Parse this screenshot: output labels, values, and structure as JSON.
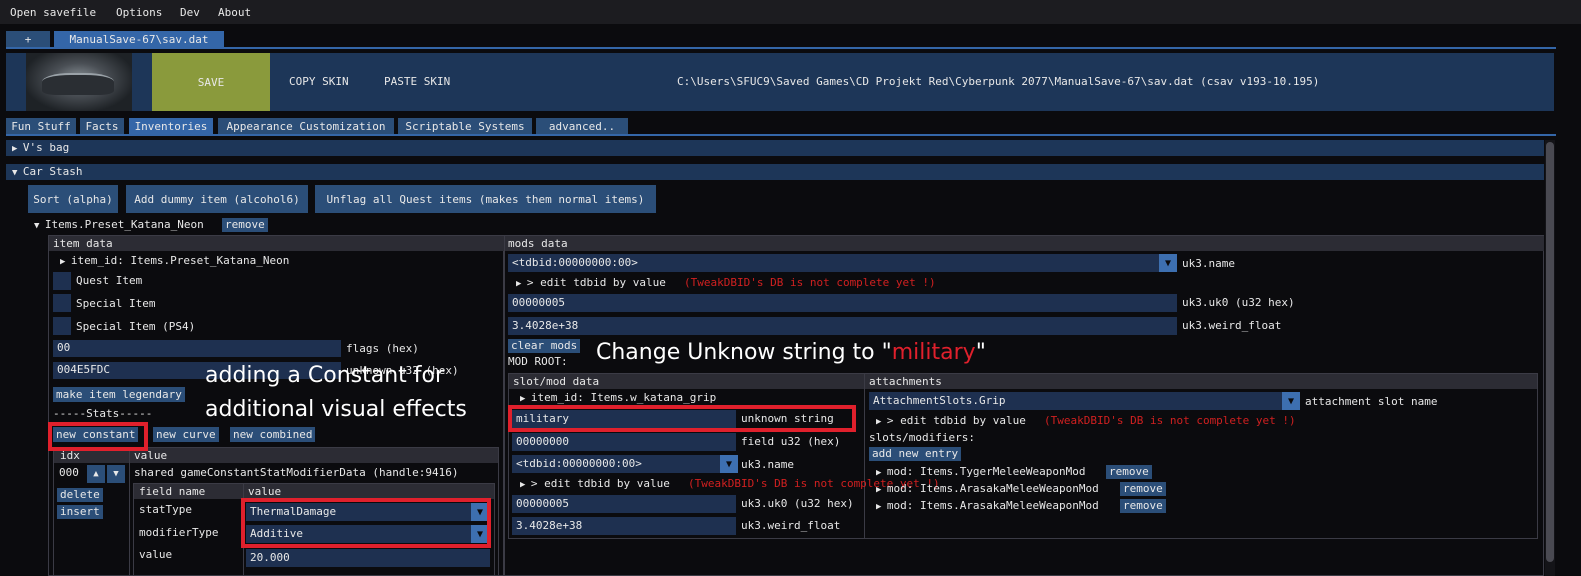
{
  "menu": [
    "Open savefile",
    "Options",
    "Dev",
    "About"
  ],
  "tabs": {
    "plus": "+",
    "file": "ManualSave-67\\sav.dat"
  },
  "toolbar": {
    "save": "SAVE",
    "copy_skin": "COPY SKIN",
    "paste_skin": "PASTE SKIN",
    "path": "C:\\Users\\SFUC9\\Saved Games\\CD Projekt Red\\Cyberpunk 2077\\ManualSave-67\\sav.dat (csav v193-10.195)"
  },
  "nav_tabs": [
    "Fun Stuff",
    "Facts",
    "Inventories",
    "Appearance Customization",
    "Scriptable Systems",
    "advanced.."
  ],
  "sections": {
    "bag": "V's bag",
    "stash": "Car Stash"
  },
  "stash_buttons": {
    "sort": "Sort (alpha)",
    "dummy": "Add dummy item (alcohol6)",
    "unflag": "Unflag all Quest items (makes them normal items)"
  },
  "item": {
    "name": "Items.Preset_Katana_Neon",
    "remove": "remove"
  },
  "item_data": {
    "header": "item data",
    "item_id": "item_id: Items.Preset_Katana_Neon",
    "quest": "Quest Item",
    "special": "Special Item",
    "special_ps4": "Special Item (PS4)",
    "flags_value": "00",
    "flags_label": "flags (hex)",
    "unknown_value": "004E5FDC",
    "unknown_label": "unknown u32 (hex)",
    "legendary": "make item legendary",
    "stats_label": "-----Stats-----",
    "new_constant": "new constant",
    "new_curve": "new curve",
    "new_combined": "new combined",
    "col_idx": "idx",
    "col_value": "value",
    "row_idx": "000",
    "shared": "shared gameConstantStatModifierData (handle:9416)",
    "delete": "delete",
    "insert": "insert",
    "sub_col_field": "field name",
    "sub_col_value": "value",
    "stat_type_label": "statType",
    "stat_type_value": "ThermalDamage",
    "modifier_type_label": "modifierType",
    "modifier_type_value": "Additive",
    "value_label": "value",
    "value_value": "20.000"
  },
  "mods_data": {
    "header": "mods data",
    "tdbid": "<tdbid:00000000:00>",
    "name_label": "uk3.name",
    "edit_tdbid": "> edit tdbid by value",
    "warning": "(TweakDBID's DB is not complete yet !)",
    "uk0_value": "00000005",
    "uk0_label": "uk3.uk0 (u32 hex)",
    "float_value": "3.4028e+38",
    "float_label": "uk3.weird_float",
    "clear_mods": "clear mods",
    "mod_root": "MOD ROOT:"
  },
  "slot": {
    "header": "slot/mod data",
    "item_id": "item_id: Items.w_katana_grip",
    "string_value": "military",
    "string_label": "unknown string",
    "u32_value": "00000000",
    "u32_label": "field u32 (hex)",
    "tdbid": "<tdbid:00000000:00>",
    "name_label": "uk3.name",
    "edit_tdbid": "> edit tdbid by value",
    "warning": "(TweakDBID's DB is not complete yet !)",
    "uk0_value": "00000005",
    "uk0_label": "uk3.uk0 (u32 hex)",
    "float_value": "3.4028e+38",
    "float_label": "uk3.weird_float"
  },
  "attachments": {
    "header": "attachments",
    "slot_value": "AttachmentSlots.Grip",
    "slot_label": "attachment slot name",
    "edit_tdbid": "> edit tdbid by value",
    "warning": "(TweakDBID's DB is not complete yet !)",
    "slots_label": "slots/modifiers:",
    "add_entry": "add new entry",
    "mods": [
      {
        "name": "mod: Items.TygerMeleeWeaponMod",
        "remove": "remove"
      },
      {
        "name": "mod: Items.ArasakaMeleeWeaponMod",
        "remove": "remove"
      },
      {
        "name": "mod: Items.ArasakaMeleeWeaponMod",
        "remove": "remove"
      }
    ]
  },
  "annotations": {
    "constant_line1": "adding a Constant for",
    "constant_line2": "additional visual effects",
    "change_prefix": "Change Unknow string to \"",
    "change_word": "military",
    "change_suffix": "\""
  },
  "colors": {
    "accent": "#2b4e78",
    "save_button": "#8a9a3c",
    "highlight_red": "#e0202c",
    "warning_red": "#d02020"
  }
}
